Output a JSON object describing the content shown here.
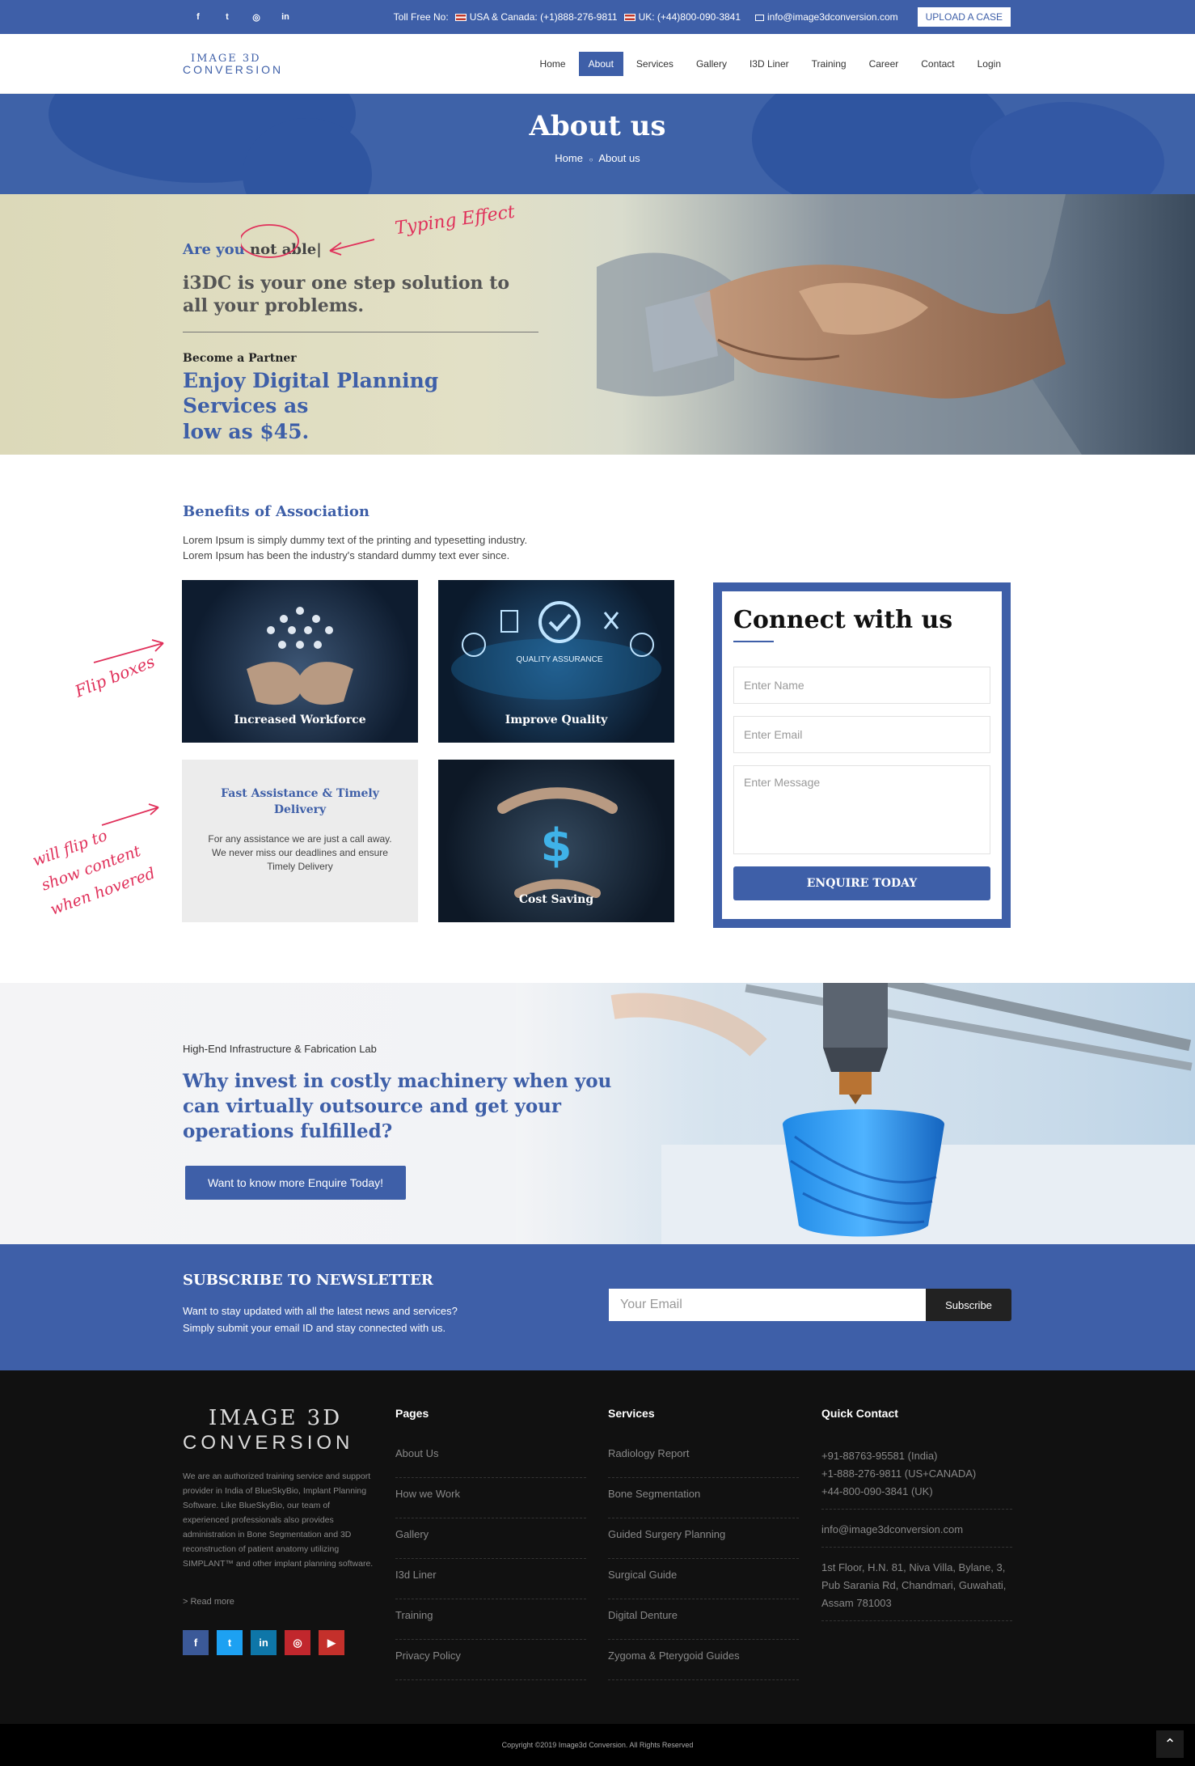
{
  "topbar": {
    "social_icons": [
      "facebook-icon",
      "twitter-icon",
      "instagram-icon",
      "linkedin-icon"
    ],
    "toll_free_label": "Toll Free No:",
    "usa_phone": "USA & Canada: (+1)888-276-9811",
    "uk_phone": "UK: (+44)800-090-3841",
    "email": "info@image3dconversion.com",
    "upload_label": "UPLOAD A CASE"
  },
  "logo": {
    "line1": "IMAGE 3D",
    "line2": "CONVERSION"
  },
  "nav": {
    "items": [
      "Home",
      "About",
      "Services",
      "Gallery",
      "I3D Liner",
      "Training",
      "Career",
      "Contact",
      "Login"
    ],
    "active": "About"
  },
  "banner": {
    "title": "About us",
    "crumb_home": "Home",
    "crumb_sep": "○",
    "crumb_current": "About us"
  },
  "hero": {
    "typing_prefix": "Are you",
    "typing_word": "not able",
    "subtitle_1": "i3DC is your one step solution to",
    "subtitle_2": "all your problems.",
    "partner_label": "Become a Partner",
    "offer_1": "Enjoy Digital Planning Services as",
    "offer_2": "low as $45.",
    "annotation": "Typing Effect"
  },
  "benefits": {
    "title": "Benefits of Association",
    "lead_1": "Lorem Ipsum is simply dummy text of the printing and typesetting industry.",
    "lead_2": "Lorem Ipsum has been the industry's standard dummy text ever since.",
    "cards": [
      {
        "caption": "Increased Workforce"
      },
      {
        "caption": "Improve Quality",
        "overlay_text": "QUALITY ASSURANCE"
      },
      {
        "title_1": "Fast Assistance & Timely",
        "title_2": "Delivery",
        "desc": "For any assistance we are just a call away. We never miss our deadlines and ensure Timely Delivery"
      },
      {
        "caption": "Cost Saving"
      }
    ],
    "annotation_flip": "Flip boxes",
    "annotation_hover_1": "will flip to",
    "annotation_hover_2": "show content",
    "annotation_hover_3": "when hovered"
  },
  "contact_form": {
    "title": "Connect with us",
    "name_placeholder": "Enter Name",
    "email_placeholder": "Enter Email",
    "message_placeholder": "Enter Message",
    "submit_label": "ENQUIRE TODAY"
  },
  "infra": {
    "small": "High-End Infrastructure & Fabrication Lab",
    "heading": "Why invest in costly machinery when you can virtually outsource and get your operations fulfilled?",
    "cta": "Want to know more Enquire Today!"
  },
  "newsletter": {
    "title": "SUBSCRIBE TO NEWSLETTER",
    "text_1": "Want to stay updated with all the latest news and services?",
    "text_2": "Simply submit your email ID and stay connected with us.",
    "placeholder": "Your Email",
    "button": "Subscribe"
  },
  "footer": {
    "about": "We are an authorized training service and support provider in India of BlueSkyBio, Implant Planning Software. Like BlueSkyBio, our team of experienced professionals also provides administration in Bone Segmentation and 3D reconstruction of patient anatomy utilizing SIMPLANT™ and other implant planning software.",
    "read_more": "> Read more",
    "social": [
      {
        "icon": "facebook-icon",
        "glyph": "f",
        "color": "#3b5998"
      },
      {
        "icon": "twitter-icon",
        "glyph": "t",
        "color": "#1da1f2"
      },
      {
        "icon": "linkedin-icon",
        "glyph": "in",
        "color": "#0e76a8"
      },
      {
        "icon": "instagram-icon",
        "glyph": "◎",
        "color": "#c1272d"
      },
      {
        "icon": "youtube-icon",
        "glyph": "▶",
        "color": "#c4302b"
      }
    ],
    "pages_title": "Pages",
    "pages": [
      "About Us",
      "How we Work",
      "Gallery",
      "I3d Liner",
      "Training",
      "Privacy Policy"
    ],
    "services_title": "Services",
    "services": [
      "Radiology Report",
      "Bone Segmentation",
      "Guided Surgery Planning",
      "Surgical Guide",
      "Digital Denture",
      "Zygoma & Pterygoid Guides"
    ],
    "contact_title": "Quick Contact",
    "phones": [
      "+91-88763-95581 (India)",
      "+1-888-276-9811 (US+CANADA)",
      "+44-800-090-3841 (UK)"
    ],
    "email": "info@image3dconversion.com",
    "address": "1st Floor, H.N. 81, Niva Villa, Bylane, 3, Pub Sarania Rd, Chandmari, Guwahati, Assam 781003",
    "copyright": "Copyright ©2019 Image3d Conversion. All Rights Reserved",
    "to_top": "⌃"
  },
  "colors": {
    "brand": "#3e5fa8",
    "annotation": "#e0305a",
    "footer_bg": "#111111"
  }
}
